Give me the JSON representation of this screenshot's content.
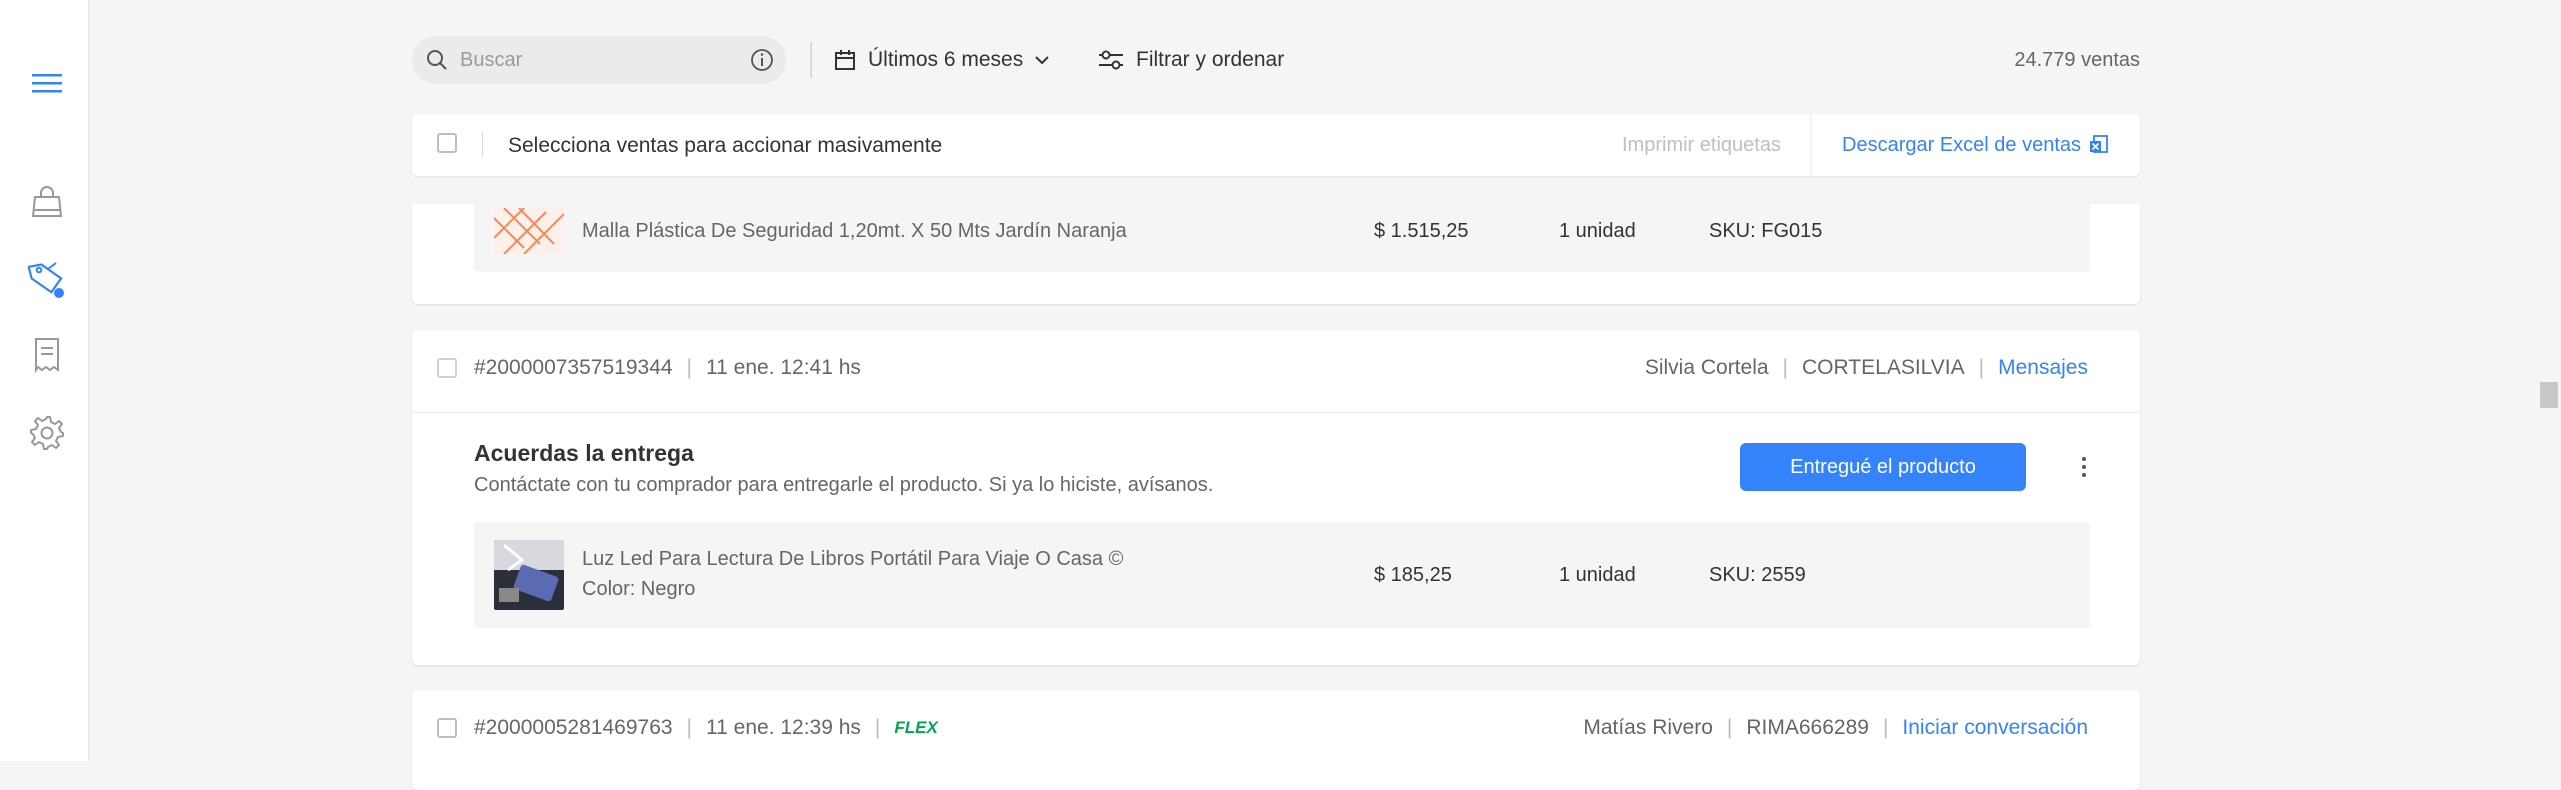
{
  "sidebar": {
    "icons": [
      "menu-icon",
      "bag-icon",
      "tag-icon",
      "receipt-icon",
      "gear-icon"
    ]
  },
  "toolbar": {
    "search_placeholder": "Buscar",
    "date_filter_label": "Últimos 6 meses",
    "filter_label": "Filtrar y ordenar",
    "sales_count": "24.779 ventas"
  },
  "bulk_actions": {
    "label": "Selecciona ventas para accionar masivamente",
    "print_labels": "Imprimir etiquetas",
    "download_excel": "Descargar Excel de ventas"
  },
  "orders": [
    {
      "product": {
        "title": "Malla Plástica De Seguridad 1,20mt. X 50 Mts Jardín Naranja",
        "price": "$ 1.515,25",
        "quantity": "1 unidad",
        "sku": "SKU: FG015"
      }
    },
    {
      "id": "#2000007357519344",
      "date": "11 ene. 12:41 hs",
      "buyer_name": "Silvia Cortela",
      "buyer_nick": "CORTELASILVIA",
      "action_link": "Mensajes",
      "status_title": "Acuerdas la entrega",
      "status_desc": "Contáctate con tu comprador para entregarle el producto. Si ya lo hiciste, avísanos.",
      "primary_action": "Entregué el producto",
      "product": {
        "title": "Luz Led Para Lectura De Libros Portátil Para Viaje O Casa ©",
        "variant": "Color: Negro",
        "price": "$ 185,25",
        "quantity": "1 unidad",
        "sku": "SKU: 2559"
      }
    },
    {
      "id": "#2000005281469763",
      "date": "11 ene. 12:39 hs",
      "badge": "FLEX",
      "buyer_name": "Matías Rivero",
      "buyer_nick": "RIMA666289",
      "action_link": "Iniciar conversación"
    }
  ],
  "colors": {
    "accent": "#3483fa",
    "flex_green": "#00a650",
    "background": "#f5f5f5"
  }
}
